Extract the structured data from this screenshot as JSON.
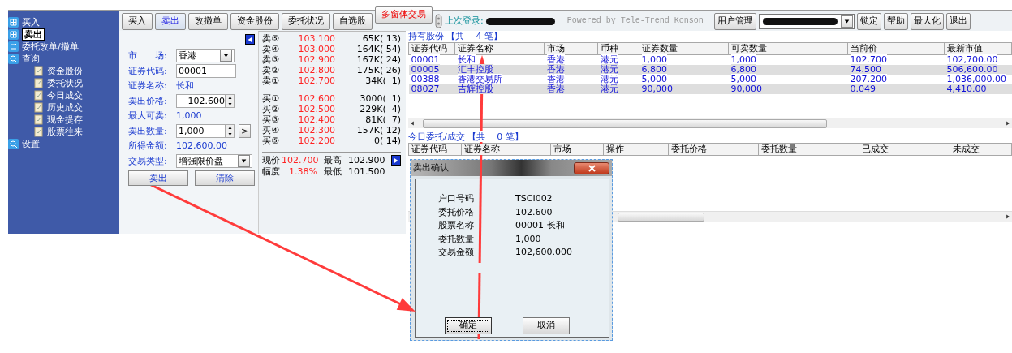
{
  "sidebar": {
    "items": [
      {
        "label": "买入",
        "kind": "order",
        "selected": false
      },
      {
        "label": "卖出",
        "kind": "order",
        "selected": true
      },
      {
        "label": "委托改单/撤单",
        "kind": "swap",
        "selected": false
      },
      {
        "label": "查询",
        "kind": "search",
        "selected": false,
        "children": [
          {
            "label": "资金股份",
            "selected": false
          },
          {
            "label": "委托状况",
            "selected": false
          },
          {
            "label": "今日成交",
            "selected": false
          },
          {
            "label": "历史成交",
            "selected": false
          },
          {
            "label": "现金提存",
            "selected": false
          },
          {
            "label": "股票往来",
            "selected": false
          }
        ]
      },
      {
        "label": "设置",
        "kind": "search",
        "selected": false
      }
    ]
  },
  "toolbar": {
    "buttons": [
      {
        "label": "买入",
        "selected": false,
        "kind": "normal"
      },
      {
        "label": "卖出",
        "selected": true,
        "kind": "normal"
      },
      {
        "label": "改撤单",
        "selected": false,
        "kind": "normal"
      },
      {
        "label": "资金股份",
        "selected": false,
        "kind": "normal"
      },
      {
        "label": "委托状况",
        "selected": false,
        "kind": "normal"
      },
      {
        "label": "自选股",
        "selected": false,
        "kind": "normal"
      },
      {
        "label": "多窗体交易",
        "selected": false,
        "kind": "alert"
      }
    ],
    "last_login_label": "上次登录:",
    "powered_by": "Powered by Tele-Trend Konson",
    "right_buttons": [
      "用户管理",
      "锁定",
      "帮助",
      "最大化",
      "退出"
    ]
  },
  "order_form": {
    "fields": [
      {
        "kind": "select",
        "label": "市　　场:",
        "value": "香港"
      },
      {
        "kind": "input",
        "label": "证券代码:",
        "value": "00001"
      },
      {
        "kind": "text",
        "label": "证券名称:",
        "value": "长和"
      },
      {
        "kind": "spin",
        "label": "卖出价格:",
        "value": "102.600"
      },
      {
        "kind": "text",
        "label": "最大可卖:",
        "value": "1,000"
      },
      {
        "kind": "spin",
        "label": "卖出数量:",
        "value": "1,000",
        "side_button": ">"
      },
      {
        "kind": "text",
        "label": "所得金额:",
        "value": "102,600.00"
      },
      {
        "kind": "select",
        "label": "交易类型:",
        "value": "增强限价盘"
      }
    ],
    "buttons": [
      "卖出",
      "清除"
    ]
  },
  "order_book": {
    "asks": [
      {
        "label": "卖⑤",
        "price": "103.100",
        "volume": "65K( 13)"
      },
      {
        "label": "卖④",
        "price": "103.000",
        "volume": "164K( 54)"
      },
      {
        "label": "卖③",
        "price": "102.900",
        "volume": "167K( 24)"
      },
      {
        "label": "卖②",
        "price": "102.800",
        "volume": "175K( 26)"
      },
      {
        "label": "卖①",
        "price": "102.700",
        "volume": "34K(  1)"
      }
    ],
    "bids": [
      {
        "label": "买①",
        "price": "102.600",
        "volume": "3000(  1)"
      },
      {
        "label": "买②",
        "price": "102.500",
        "volume": "229K(  4)"
      },
      {
        "label": "买③",
        "price": "102.400",
        "volume": "81K(  7)"
      },
      {
        "label": "买④",
        "price": "102.300",
        "volume": "157K( 12)"
      },
      {
        "label": "买⑤",
        "price": "102.200",
        "volume": "0( 14)"
      }
    ],
    "summary": [
      {
        "label": "现价",
        "value": "102.700",
        "label2": "最高",
        "value2": "102.900"
      },
      {
        "label": "幅度",
        "value": "1.38%",
        "label2": "最低",
        "value2": "101.500"
      }
    ]
  },
  "holdings": {
    "title": "持有股份",
    "count": "【共    4 笔】",
    "columns": [
      "证券代码",
      "证券名称",
      "市场",
      "币种",
      "证券数量",
      "可卖数量",
      "当前价",
      "最新市值"
    ],
    "rows": [
      [
        "00001",
        "长和",
        "香港",
        "港元",
        "1,000",
        "1,000",
        "102.700",
        "102,700.00"
      ],
      [
        "00005",
        "汇丰控股",
        "香港",
        "港元",
        "6,800",
        "6,800",
        "74.500",
        "506,600.00"
      ],
      [
        "00388",
        "香港交易所",
        "香港",
        "港元",
        "5,000",
        "5,000",
        "207.200",
        "1,036,000.00"
      ],
      [
        "08027",
        "吉辉控股",
        "香港",
        "港元",
        "90,000",
        "90,000",
        "0.049",
        "4,410.00"
      ]
    ]
  },
  "orders": {
    "title": "今日委托/成交",
    "count": "【共    0 笔】",
    "columns": [
      "证券代码",
      "证券名称",
      "市场",
      "操作",
      "委托价格",
      "委托数量",
      "已成交",
      "未成交"
    ]
  },
  "dialog": {
    "title": "卖出确认",
    "rows": [
      {
        "label": "户口号码",
        "value": "TSCI002"
      },
      {
        "label": "委托价格",
        "value": "102.600"
      },
      {
        "label": "股票名称",
        "value": "00001-长和"
      },
      {
        "label": "委托数量",
        "value": "1,000"
      },
      {
        "label": "交易金额",
        "value": "102,600.000"
      }
    ],
    "separator": "----------------------",
    "buttons": [
      {
        "label": "确定",
        "selected": true
      },
      {
        "label": "取消",
        "selected": false
      }
    ]
  }
}
